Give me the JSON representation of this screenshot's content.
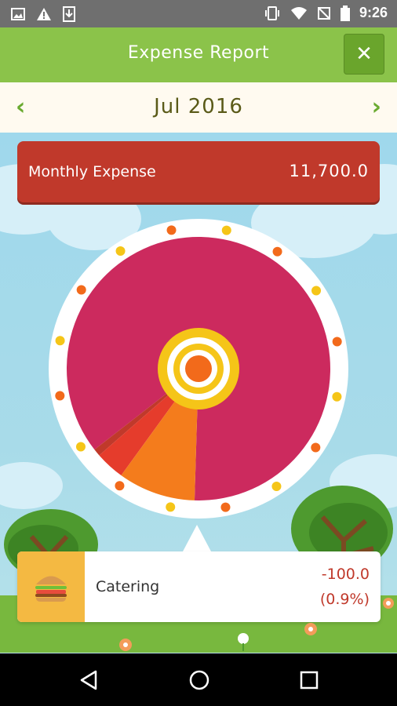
{
  "status_bar": {
    "time": "9:26",
    "icons": [
      "image-icon",
      "alert-icon",
      "download-icon",
      "vibrate-icon",
      "wifi-icon",
      "no-sim-icon",
      "battery-icon"
    ]
  },
  "header": {
    "title": "Expense Report",
    "close_icon": "close-icon"
  },
  "month_nav": {
    "month": "Jul 2016",
    "prev_icon": "chevron-left-icon",
    "next_icon": "chevron-right-icon"
  },
  "summary": {
    "label": "Monthly Expense",
    "amount": "11,700.0"
  },
  "chart_data": {
    "type": "pie",
    "slices": [
      {
        "value": 86.0,
        "color": "#cc2a5e"
      },
      {
        "value": 9.5,
        "color": "#f47c1c"
      },
      {
        "value": 3.6,
        "color": "#e53c2c"
      },
      {
        "value": 0.9,
        "color": "#c0392b"
      }
    ]
  },
  "detail": {
    "category": "Catering",
    "value": "-100.0",
    "percent": "(0.9%)",
    "icon": "burger-icon"
  },
  "nav": {
    "back_icon": "back-icon",
    "home_icon": "home-icon",
    "recents_icon": "recents-icon"
  },
  "colors": {
    "header": "#8bc34a",
    "card": "#c0392b",
    "accent": "#f5c518"
  }
}
